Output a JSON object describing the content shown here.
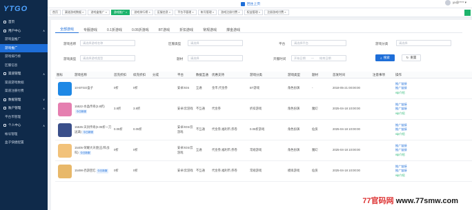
{
  "app": {
    "logo": "YTGO"
  },
  "sidebar": {
    "items": [
      {
        "label": "首页",
        "kind": "group"
      },
      {
        "label": "用户中心",
        "kind": "group",
        "arrow": "∧"
      },
      {
        "label": "游戏盒推广",
        "kind": "sub"
      },
      {
        "label": "游戏推广",
        "kind": "sub",
        "active": true
      },
      {
        "label": "游戏排行榜",
        "kind": "sub"
      },
      {
        "label": "区服信息",
        "kind": "sub"
      },
      {
        "label": "渠道管理",
        "kind": "group",
        "arrow": "∧"
      },
      {
        "label": "渠道游戏数据",
        "kind": "sub"
      },
      {
        "label": "渠道注册付费",
        "kind": "sub"
      },
      {
        "label": "数据管理",
        "kind": "group",
        "arrow": "∨"
      },
      {
        "label": "账户管理",
        "kind": "group",
        "arrow": "∧"
      },
      {
        "label": "平台币管理",
        "kind": "sub"
      },
      {
        "label": "个人中心",
        "kind": "group",
        "arrow": "∧"
      },
      {
        "label": "帐号管理",
        "kind": "sub"
      },
      {
        "label": "盒子快捷配置",
        "kind": "sub"
      }
    ]
  },
  "header": {
    "home_label": "回主上页",
    "username": "yx@**** ▾"
  },
  "tabbar": {
    "tabs": [
      {
        "label": "首页"
      },
      {
        "label": "渠道游戏数据 ×"
      },
      {
        "label": "游戏盒推广 ×"
      },
      {
        "label": "游戏推广 ×",
        "active": true
      },
      {
        "label": "游戏排行榜 ×"
      },
      {
        "label": "区服信息 ×"
      },
      {
        "label": "平台币管理 ×"
      },
      {
        "label": "帐号管理 ×"
      },
      {
        "label": "游戏注册付费 ×"
      },
      {
        "label": "权益管理 ×"
      },
      {
        "label": "注册游戏付费 ×"
      }
    ]
  },
  "content_tabs": [
    {
      "label": "全部游戏",
      "active": true
    },
    {
      "label": "专服游戏"
    },
    {
      "label": "0.1折游戏"
    },
    {
      "label": "0.05折游戏"
    },
    {
      "label": "BT游戏"
    },
    {
      "label": "折扣游戏"
    },
    {
      "label": "常规游戏"
    },
    {
      "label": "撑金游戏"
    }
  ],
  "filters": {
    "game_name": {
      "label": "游戏名称",
      "placeholder": "请选择游戏名称"
    },
    "zone_type": {
      "label": "区服类型",
      "placeholder": "请选择"
    },
    "platform": {
      "label": "平台",
      "placeholder": "请选择平台"
    },
    "game_category": {
      "label": "游戏分类",
      "placeholder": "请选择"
    },
    "game_type": {
      "label": "游戏类型",
      "placeholder": "请选择游戏类型"
    },
    "theme": {
      "label": "题材",
      "placeholder": "请选择"
    },
    "time": {
      "label": "开服时间",
      "start_placeholder": "开始日期",
      "end_placeholder": "结束日期"
    },
    "search_label": "搜索",
    "reset_label": "重置"
  },
  "table": {
    "headers": [
      "图标",
      "游戏名称",
      "首充折扣",
      "续充折扣",
      "分成",
      "平台",
      "数据互通",
      "优惠支持",
      "游戏分类",
      "游戏类型",
      "题材",
      "首发时间",
      "注意事项",
      "操作"
    ],
    "rows": [
      {
        "icon_color": "#1e88e5",
        "name": "10-BTGO盒子",
        "badge": "",
        "first": "0折",
        "cont": "0折",
        "fen": "",
        "plat": "安卓/IOS",
        "comm": "互通",
        "sup": "金币,代金券",
        "cat": "BT游戏",
        "type": "角色扮演",
        "theme": "-",
        "ftime": "2018-05-21 00:00:00",
        "note": "",
        "op1": "推广链接",
        "op2": "推广链接",
        "op3": "vip介绍"
      },
      {
        "icon_color": "#e57fb0",
        "name": "15522-水晶传奇(3.8折)",
        "badge": "今日新服",
        "first": "3.8折",
        "cont": "3.8折",
        "fen": "",
        "plat": "安卓/云游戏",
        "comm": "不互通",
        "sup": "代金券",
        "cat": "折扣游戏",
        "type": "角色扮演",
        "theme": "魔幻",
        "ftime": "2025-04-18 10:00:00",
        "note": "",
        "op1": "推广链接",
        "op2": "推广链接",
        "op3": "vip介绍"
      },
      {
        "icon_color": "#3a4f8a",
        "name": "15535-天剑传奇(0.05折一刀送满)",
        "badge": "今日新服",
        "first": "0.05折",
        "cont": "0.05折",
        "fen": "",
        "plat": "安卓/IOS/云游戏",
        "comm": "不互通",
        "sup": "代金券,福利币,券卷",
        "cat": "0.05折游戏",
        "type": "角色扮演",
        "theme": "仙侠",
        "ftime": "2025-04-18 10:00:00",
        "note": "",
        "op1": "推广链接",
        "op2": "推广链接",
        "op3": "vip介绍"
      },
      {
        "icon_color": "#f2c27a",
        "name": "15405-荣耀大天使(五/阵战科)",
        "badge": "今日新服",
        "first": "0折",
        "cont": "0折",
        "fen": "",
        "plat": "安卓/IOS/云游戏",
        "comm": "互通",
        "sup": "代金券,福利币,券卷",
        "cat": "常规游戏",
        "type": "角色扮演",
        "theme": "魔幻",
        "ftime": "2025-04-18 10:00:00",
        "note": "",
        "op1": "推广链接",
        "op2": "推广链接",
        "op3": "vip介绍"
      },
      {
        "icon_color": "#e8b86a",
        "name": "15498-西游回忆",
        "badge": "今日新服",
        "first": "0折",
        "cont": "0折",
        "fen": "",
        "plat": "安卓/云游戏",
        "comm": "不互通",
        "sup": "代金券,福利币,券卷",
        "cat": "常规游戏",
        "type": "模拟游戏",
        "theme": "仙侠",
        "ftime": "2025-04-18 10:00:00",
        "note": "",
        "op1": "推广链接",
        "op2": "推广链接",
        "op3": "vip介绍"
      }
    ]
  },
  "watermark": {
    "prefix": "77官码网",
    "url": "www.77smw.com"
  }
}
